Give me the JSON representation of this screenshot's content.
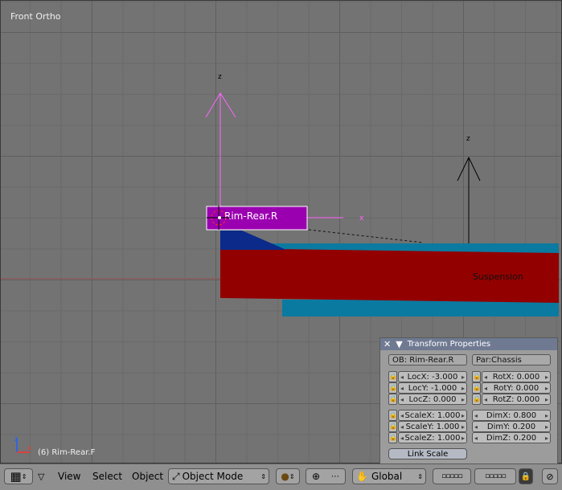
{
  "viewport": {
    "view_label": "Front Ortho",
    "object_status": "(6) Rim-Rear.F",
    "selected_object_label": "Rim-Rear.R",
    "suspension_label": "Suspension",
    "axis_z": "z",
    "axis_x": "x",
    "colors": {
      "magenta": "#ff66ff",
      "blue": "#0b2a8a",
      "red": "#920000",
      "teal": "#0b7aa0",
      "purple": "#9b00b0"
    }
  },
  "transform": {
    "title": "Transform Properties",
    "ob": "OB: Rim-Rear.R",
    "par": "Par:Chassis",
    "loc": [
      "LocX: -3.000",
      "LocY: -1.000",
      "LocZ: 0.000"
    ],
    "rot": [
      "RotX: 0.000",
      "RotY: 0.000",
      "RotZ: 0.000"
    ],
    "scale": [
      "ScaleX: 1.000",
      "ScaleY: 1.000",
      "ScaleZ: 1.000"
    ],
    "dim": [
      "DimX: 0.800",
      "DimY: 0.200",
      "DimZ: 0.200"
    ],
    "link_scale": "Link Scale"
  },
  "header": {
    "menus": [
      "View",
      "Select",
      "Object"
    ],
    "mode": "Object Mode",
    "orientation": "Global"
  }
}
